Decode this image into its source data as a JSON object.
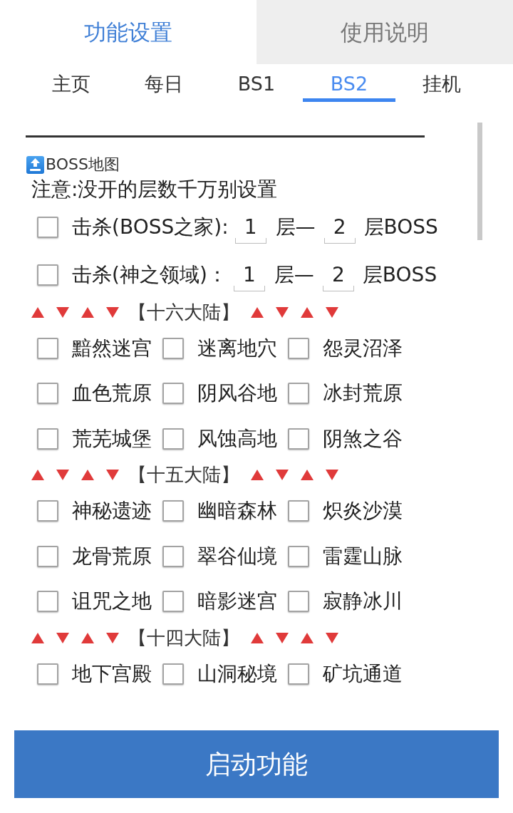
{
  "header_tabs": [
    {
      "label": "功能设置",
      "selected": true
    },
    {
      "label": "使用说明",
      "selected": false
    }
  ],
  "sub_tabs": [
    {
      "label": "主页",
      "selected": false
    },
    {
      "label": "每日",
      "selected": false
    },
    {
      "label": "BS1",
      "selected": false
    },
    {
      "label": "BS2",
      "selected": true
    },
    {
      "label": "挂机",
      "selected": false
    }
  ],
  "section_title": "BOSS地图",
  "notice": "注意:没开的层数千万别设置",
  "kill_rows": [
    {
      "label": "击杀(BOSS之家):",
      "checked": false,
      "from": "1",
      "middle": "层—",
      "to": "2",
      "suffix": "层BOSS"
    },
    {
      "label": "击杀(神之领域)：",
      "checked": false,
      "from": "1",
      "middle": "层—",
      "to": "2",
      "suffix": "层BOSS"
    }
  ],
  "continents": [
    {
      "title": "【十六大陆】",
      "maps": [
        {
          "label": "黯然迷宫",
          "checked": false
        },
        {
          "label": "迷离地穴",
          "checked": false
        },
        {
          "label": "怨灵沼泽",
          "checked": false
        },
        {
          "label": "血色荒原",
          "checked": false
        },
        {
          "label": "阴风谷地",
          "checked": false
        },
        {
          "label": "冰封荒原",
          "checked": false
        },
        {
          "label": "荒芜城堡",
          "checked": false
        },
        {
          "label": "风蚀高地",
          "checked": false
        },
        {
          "label": "阴煞之谷",
          "checked": false
        }
      ]
    },
    {
      "title": "【十五大陆】",
      "maps": [
        {
          "label": "神秘遗迹",
          "checked": false
        },
        {
          "label": "幽暗森林",
          "checked": false
        },
        {
          "label": "炽炎沙漠",
          "checked": false
        },
        {
          "label": "龙骨荒原",
          "checked": false
        },
        {
          "label": "翠谷仙境",
          "checked": false
        },
        {
          "label": "雷霆山脉",
          "checked": false
        },
        {
          "label": "诅咒之地",
          "checked": false
        },
        {
          "label": "暗影迷宫",
          "checked": false
        },
        {
          "label": "寂静冰川",
          "checked": false
        }
      ]
    },
    {
      "title": "【十四大陆】",
      "maps": [
        {
          "label": "地下宫殿",
          "checked": false
        },
        {
          "label": "山洞秘境",
          "checked": false
        },
        {
          "label": "矿坑通道",
          "checked": false
        }
      ]
    }
  ],
  "start_button": "启动功能"
}
